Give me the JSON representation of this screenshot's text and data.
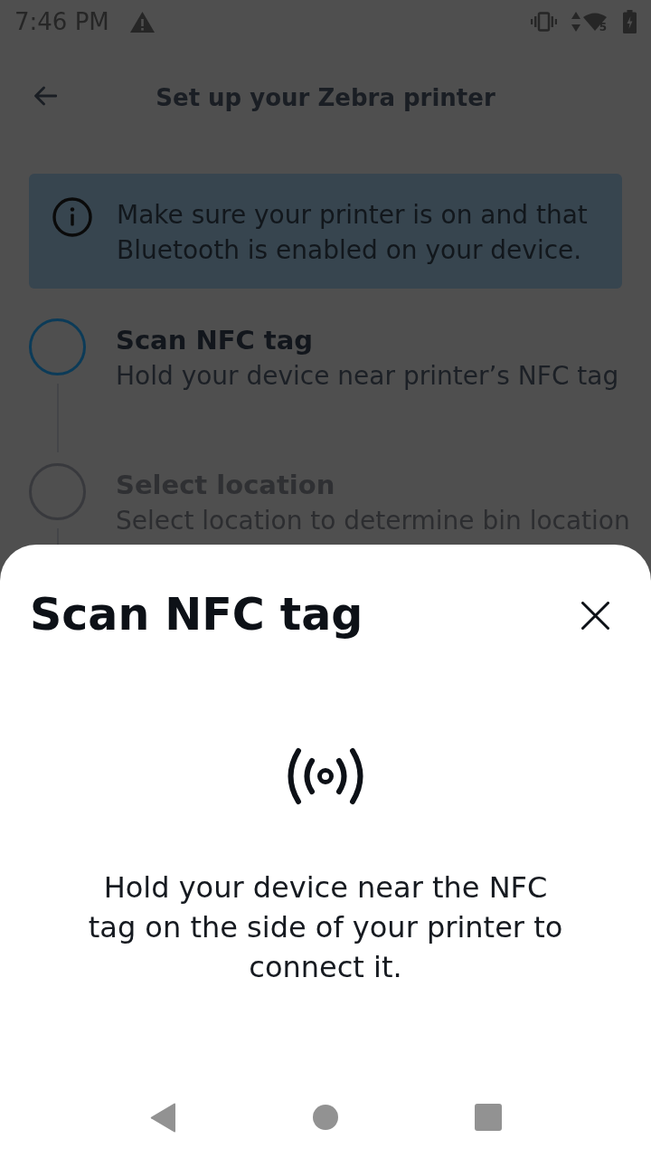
{
  "status_bar": {
    "time": "7:46 PM",
    "network_type": "5"
  },
  "app_bar": {
    "title": "Set up your Zebra printer"
  },
  "info_banner": {
    "text": "Make sure your printer is on and that Bluetooth is enabled on your device."
  },
  "steps": [
    {
      "title": "Scan NFC tag",
      "description": "Hold your device near printer’s NFC tag",
      "active": true
    },
    {
      "title": "Select location",
      "description": "Select location to determine bin location",
      "active": false
    }
  ],
  "bottom_sheet": {
    "title": "Scan NFC tag",
    "message": "Hold your device near the NFC tag on the side of your printer to connect it."
  }
}
